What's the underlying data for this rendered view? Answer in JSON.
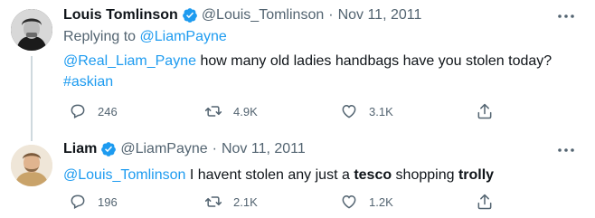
{
  "tweets": [
    {
      "display_name": "Louis Tomlinson",
      "handle": "@Louis_Tomlinson",
      "separator": "·",
      "date": "Nov 11, 2011",
      "replying_prefix": "Replying to ",
      "replying_to": "@LiamPayne",
      "mention": "@Real_Liam_Payne",
      "text": " how many old ladies handbags have you stolen today?",
      "hashtag": "#askian",
      "replies": "246",
      "retweets": "4.9K",
      "likes": "3.1K"
    },
    {
      "display_name": "Liam",
      "handle": "@LiamPayne",
      "separator": "·",
      "date": "Nov 11, 2011",
      "mention": "@Louis_Tomlinson",
      "text_a": " I havent stolen any just a ",
      "text_bold_1": "tesco",
      "text_b": " shopping ",
      "text_bold_2": "trolly",
      "replies": "196",
      "retweets": "2.1K",
      "likes": "1.2K"
    }
  ],
  "colors": {
    "link": "#1d9bf0",
    "secondary": "#536471",
    "verified": "#1d9bf0"
  },
  "icons": [
    "verified-badge-icon",
    "more-icon",
    "reply-icon",
    "retweet-icon",
    "like-icon",
    "share-icon"
  ]
}
